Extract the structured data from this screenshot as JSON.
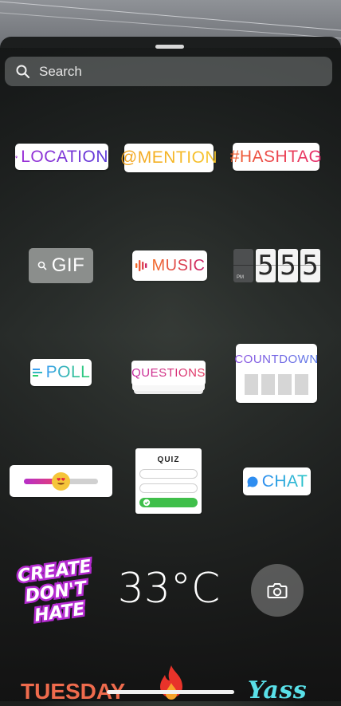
{
  "search": {
    "placeholder": "Search"
  },
  "stickers": {
    "location": "LOCATION",
    "mention": "@MENTION",
    "hashtag": "#HASHTAG",
    "gif": "GIF",
    "music": "MUSIC",
    "clock": {
      "digits": [
        "5",
        "5",
        "5"
      ],
      "period": "PM"
    },
    "poll": "POLL",
    "questions": "QUESTIONS",
    "countdown": "COUNTDOWN",
    "slider": {
      "emoji": "heart-eyes-face",
      "level": 0.48
    },
    "quiz": "QUIZ",
    "chat": "CHAT",
    "create_dont_hate": [
      "CREATE",
      "DON'T",
      "HATE"
    ],
    "temperature": "33°C",
    "tuesday": "TUESDAY",
    "yass": "Yass"
  },
  "colors": {
    "location": "#7b35d8",
    "mention": "#f4b223",
    "hashtag": "#e83f6f",
    "poll": "#2fb8a0",
    "chat": "#2e8df0"
  }
}
